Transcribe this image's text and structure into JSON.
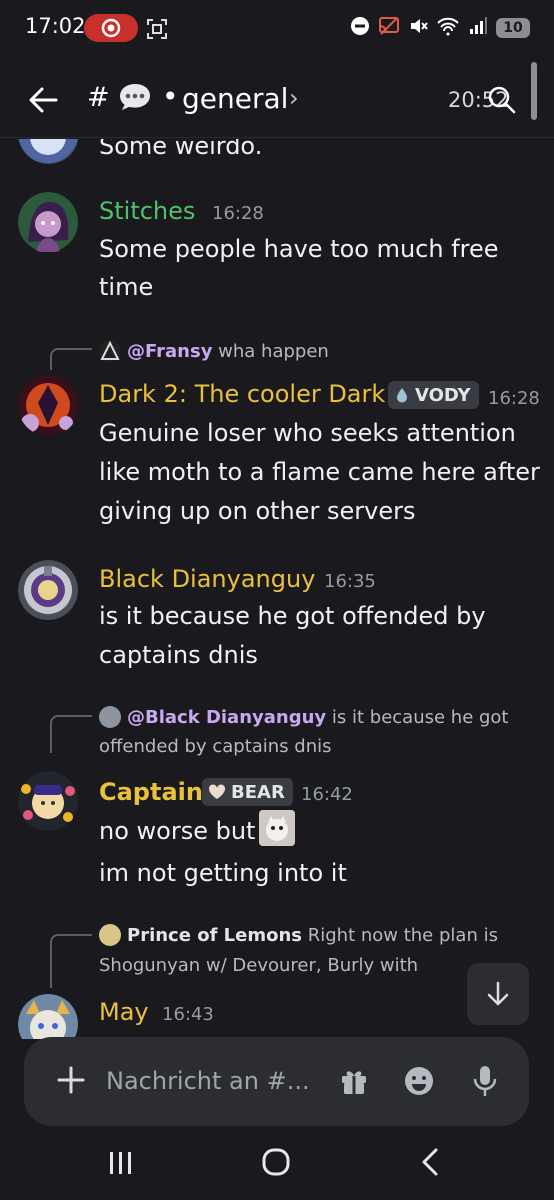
{
  "status_bar": {
    "time": "17:02",
    "battery": "10",
    "icons": [
      "screen-record-icon",
      "screenshot-icon",
      "do-not-disturb-icon",
      "cast-icon",
      "mute-icon",
      "wifi-icon",
      "signal-icon",
      "battery-icon"
    ]
  },
  "header": {
    "hash": "#",
    "channel_name": "general",
    "chevron": "›",
    "time": "20:52",
    "separator": "•"
  },
  "messages": [
    {
      "text_partial": "Some weirdo."
    },
    {
      "user": "Stitches",
      "user_color": "#4fc26b",
      "time": "16:28",
      "lines": [
        "Some people have too much free",
        "time"
      ]
    },
    {
      "reply": {
        "name": "@Fransy",
        "text": "wha happen"
      },
      "user": "Dark 2: The cooler Dark",
      "user_color": "#e9c13b",
      "tag": "VODY",
      "time": "16:28",
      "lines": [
        "Genuine loser who seeks attention",
        "like moth to a flame came here after",
        "giving up on other servers"
      ]
    },
    {
      "user": "Black Dianyanguy",
      "user_color": "#e9c13b",
      "time": "16:35",
      "lines": [
        "is it because he got offended by",
        "captains dnis"
      ]
    },
    {
      "reply": {
        "name": "@Black Dianyanguy",
        "text": "is it because he got",
        "text2": "offended by captains dnis"
      },
      "user": "Captain",
      "user_color": "#e9c13b",
      "tag": "BEAR",
      "time": "16:42",
      "lines": [
        "no worse but",
        "im not getting into it"
      ]
    },
    {
      "reply": {
        "name": "Prince of Lemons",
        "text": "Right now the plan is",
        "text2": "Shogunyan w/ Devourer, Burly with"
      },
      "user": "May",
      "user_color": "#e9c13b",
      "time": "16:43"
    }
  ],
  "composer": {
    "placeholder": "Nachricht an #..."
  },
  "colors": {
    "background": "#1a1a1e",
    "accent_green": "#4fc26b",
    "accent_gold": "#e9c13b",
    "reply_name": "#c9a8f2"
  }
}
